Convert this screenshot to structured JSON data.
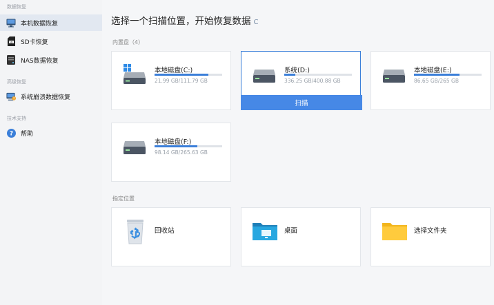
{
  "sidebar": {
    "section_data_recovery": "数据恢复",
    "items_recovery": [
      {
        "label": "本机数据恢复",
        "icon": "monitor-icon",
        "active": true
      },
      {
        "label": "SD卡恢复",
        "icon": "sd-card-icon"
      },
      {
        "label": "NAS数据恢复",
        "icon": "nas-icon"
      }
    ],
    "section_advanced": "高级恢复",
    "items_advanced": [
      {
        "label": "系统崩溃数据恢复",
        "icon": "system-crash-icon"
      }
    ],
    "section_support": "技术支持",
    "items_support": [
      {
        "label": "帮助",
        "icon": "help-icon"
      }
    ]
  },
  "main": {
    "title": "选择一个扫描位置，开始恢复数据",
    "refresh_glyph": "C",
    "internal_label": "内置盘（4）",
    "disks": [
      {
        "name": "本地磁盘(C:)",
        "size": "21.99 GB/111.79 GB",
        "used_fraction": 0.8,
        "icon": "windows-disk-icon"
      },
      {
        "name": "系统(D:)",
        "size": "336.25 GB/400.88 GB",
        "used_fraction": 0.16,
        "selected": true,
        "icon": "disk-icon"
      },
      {
        "name": "本地磁盘(E:)",
        "size": "86.65 GB/265 GB",
        "used_fraction": 0.67,
        "icon": "disk-icon"
      },
      {
        "name": "本地磁盘(F:)",
        "size": "98.14 GB/265.63 GB",
        "used_fraction": 0.63,
        "icon": "disk-icon"
      }
    ],
    "scan_label": "扫描",
    "specific_label": "指定位置",
    "locations": [
      {
        "name": "回收站",
        "icon": "recycle-bin-icon"
      },
      {
        "name": "桌面",
        "icon": "desktop-folder-icon"
      },
      {
        "name": "选择文件夹",
        "icon": "folder-icon"
      }
    ]
  },
  "colors": {
    "accent": "#4688e6",
    "sidebar_active": "#e2e8f1"
  }
}
